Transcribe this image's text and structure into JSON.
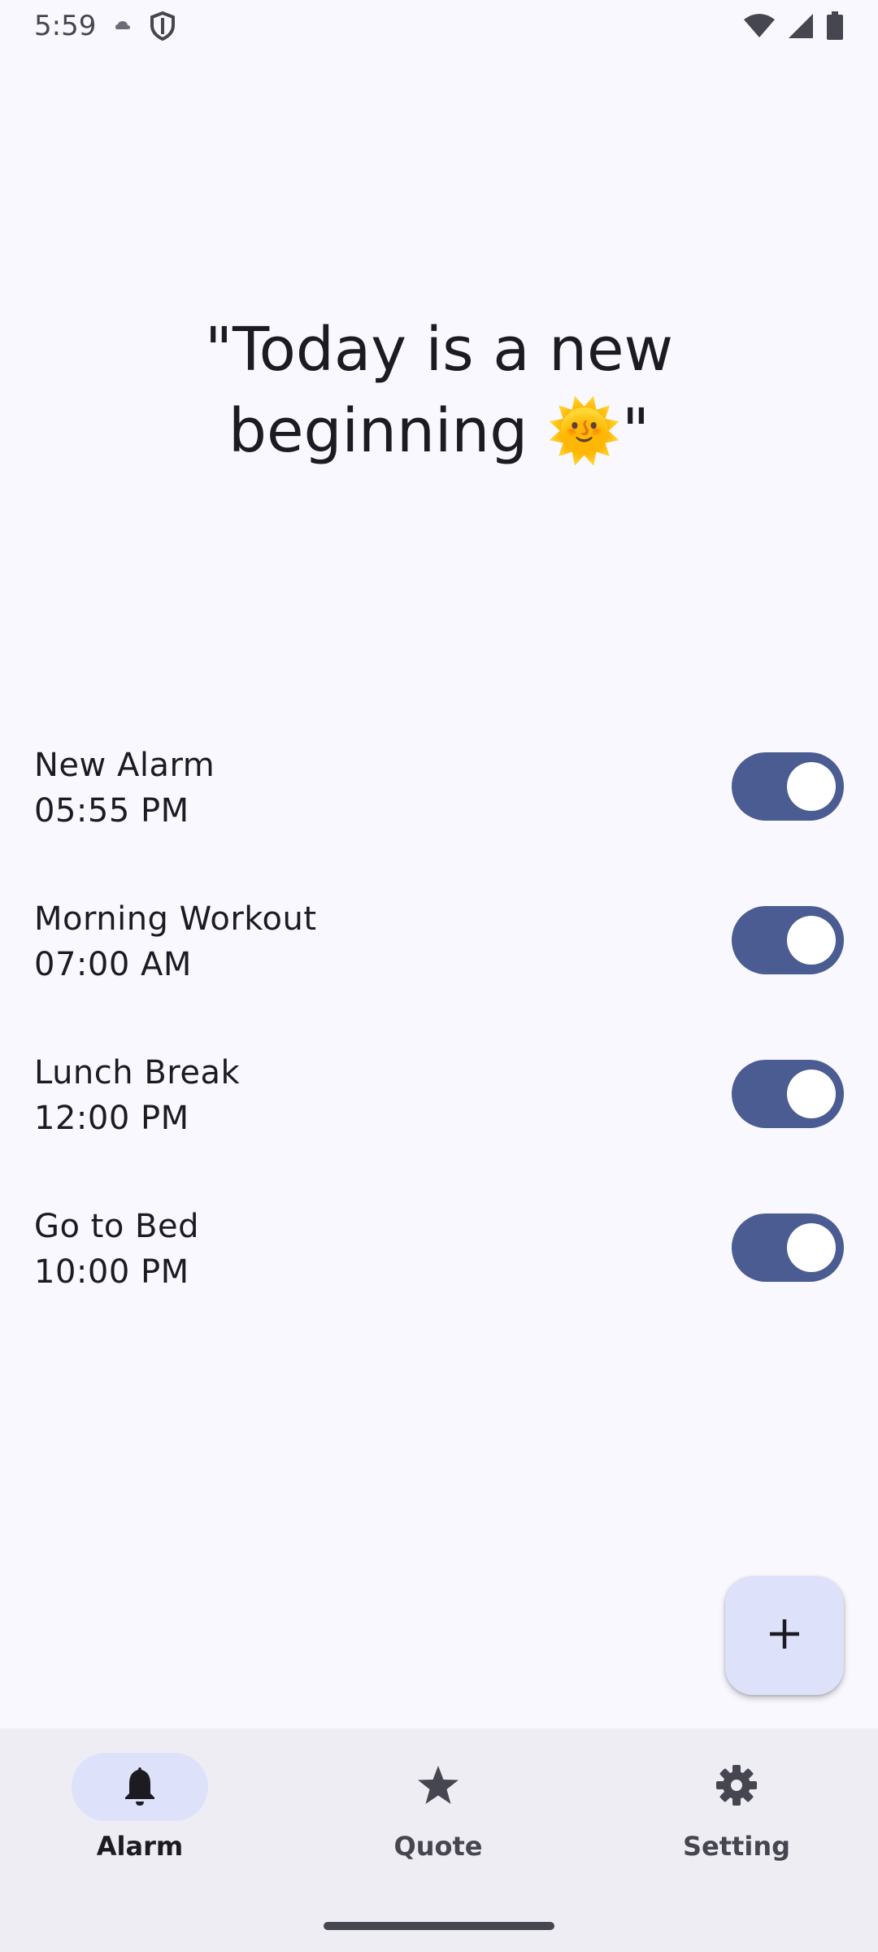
{
  "status_bar": {
    "time": "5:59",
    "icons": [
      "cloud-icon",
      "shield-icon",
      "wifi-icon",
      "signal-icon",
      "battery-icon"
    ]
  },
  "quote": {
    "text": "\"Today is a new beginning 🌞\""
  },
  "alarms": [
    {
      "name": "New Alarm",
      "time": "05:55 PM",
      "enabled": true
    },
    {
      "name": "Morning Workout",
      "time": "07:00 AM",
      "enabled": true
    },
    {
      "name": "Lunch Break",
      "time": "12:00 PM",
      "enabled": true
    },
    {
      "name": "Go to Bed",
      "time": "10:00 PM",
      "enabled": true
    }
  ],
  "fab": {
    "icon": "plus-icon"
  },
  "bottom_nav": {
    "active": "Alarm",
    "items": [
      {
        "label": "Alarm",
        "icon": "bell-icon"
      },
      {
        "label": "Quote",
        "icon": "star-icon"
      },
      {
        "label": "Setting",
        "icon": "gear-icon"
      }
    ]
  },
  "colors": {
    "background": "#f9f8fe",
    "switch_track": "#4a5c92",
    "accent_container": "#dde1fa",
    "nav_background": "#efedf4"
  }
}
